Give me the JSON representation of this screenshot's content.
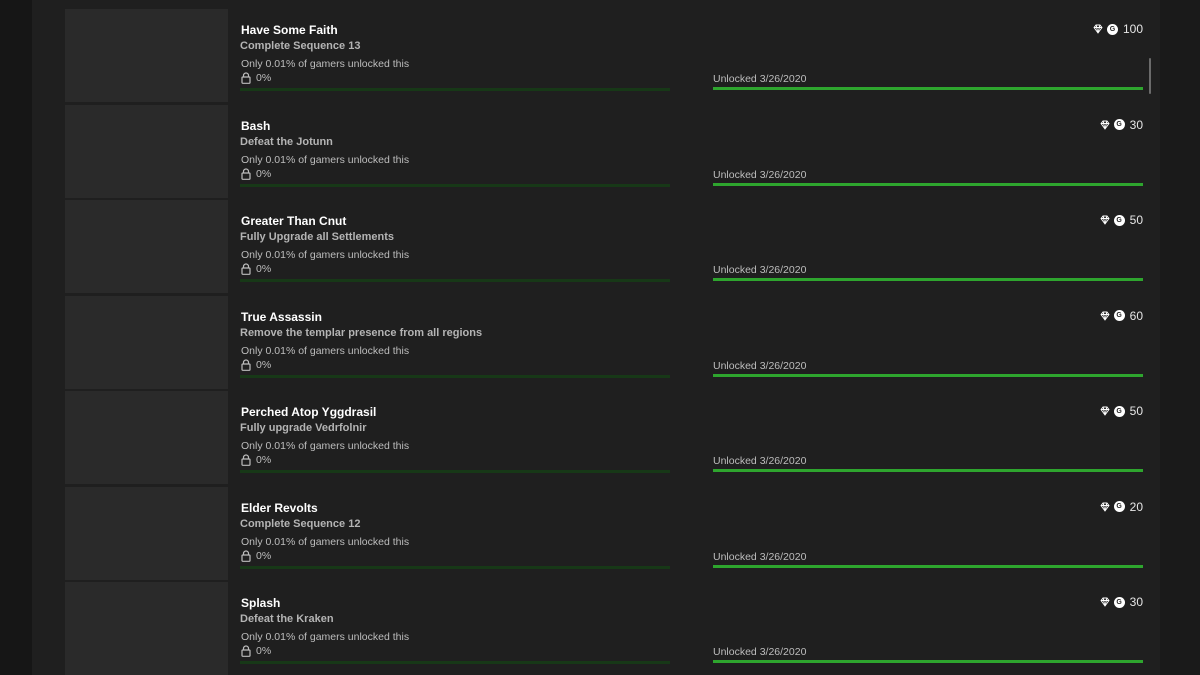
{
  "achievements": [
    {
      "title": "Have Some Faith",
      "description": "Complete Sequence 13",
      "rarity": "Only 0.01% of gamers unlocked this",
      "progress": "0%",
      "unlocked": "Unlocked 3/26/2020",
      "score": "100"
    },
    {
      "title": "Bash",
      "description": "Defeat the Jotunn",
      "rarity": "Only 0.01% of gamers unlocked this",
      "progress": "0%",
      "unlocked": "Unlocked 3/26/2020",
      "score": "30"
    },
    {
      "title": "Greater Than Cnut",
      "description": "Fully Upgrade all Settlements",
      "rarity": "Only 0.01% of gamers unlocked this",
      "progress": "0%",
      "unlocked": "Unlocked 3/26/2020",
      "score": "50"
    },
    {
      "title": "True Assassin",
      "description": "Remove the templar presence from all regions",
      "rarity": "Only 0.01% of gamers unlocked this",
      "progress": "0%",
      "unlocked": "Unlocked 3/26/2020",
      "score": "60"
    },
    {
      "title": "Perched Atop Yggdrasil",
      "description": "Fully upgrade Vedrfolnir",
      "rarity": "Only 0.01% of gamers unlocked this",
      "progress": "0%",
      "unlocked": "Unlocked 3/26/2020",
      "score": "50"
    },
    {
      "title": "Elder Revolts",
      "description": "Complete Sequence 12",
      "rarity": "Only 0.01% of gamers unlocked this",
      "progress": "0%",
      "unlocked": "Unlocked 3/26/2020",
      "score": "20"
    },
    {
      "title": "Splash",
      "description": "Defeat the Kraken",
      "rarity": "Only 0.01% of gamers unlocked this",
      "progress": "0%",
      "unlocked": "Unlocked 3/26/2020",
      "score": "30"
    }
  ],
  "icons": {
    "gem": "gem-icon",
    "gamerscore": "G",
    "lock": "lock-icon"
  },
  "colors": {
    "unlock_bar": "#2ea52e",
    "rarity_bar": "#173817"
  }
}
